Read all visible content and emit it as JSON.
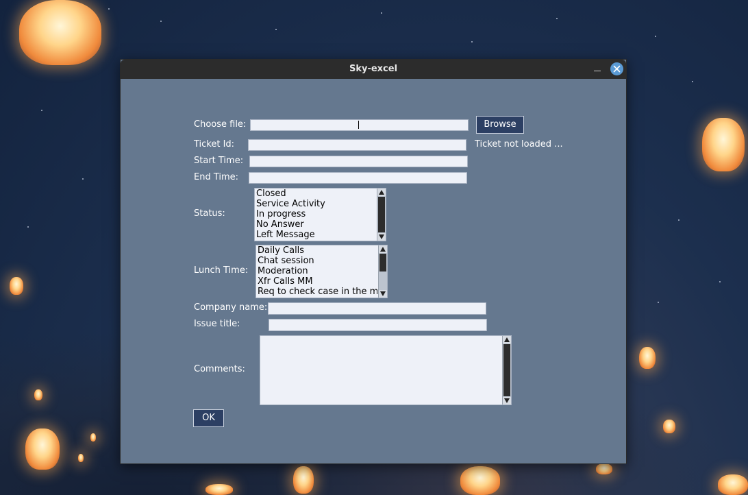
{
  "window": {
    "title": "Sky-excel"
  },
  "form": {
    "choose_file_label": "Choose file:",
    "browse_label": "Browse",
    "ticket_id_label": "Ticket Id:",
    "ticket_status_text": "Ticket not loaded ...",
    "start_time_label": "Start Time:",
    "end_time_label": "End Time:",
    "status_label": "Status:",
    "status_options": [
      "Closed",
      "Service Activity",
      "In progress",
      "No Answer",
      "Left Message"
    ],
    "lunch_time_label": "Lunch Time:",
    "lunch_options": [
      "Daily Calls",
      "Chat session",
      "Moderation",
      "Xfr Calls MM",
      "Req to check case in the mor"
    ],
    "company_name_label": "Company name:",
    "issue_title_label": "Issue title:",
    "comments_label": "Comments:",
    "ok_label": "OK"
  },
  "icons": {
    "minimize": "minimize-icon",
    "close": "close-icon",
    "scroll_up": "arrow-up-icon",
    "scroll_down": "arrow-down-icon"
  },
  "colors": {
    "window_bg": "#65788f",
    "titlebar": "#2c2c2c",
    "button_bg": "#2c3f63",
    "close_button": "#5b9bd5",
    "field_bg": "#eef1f8"
  }
}
